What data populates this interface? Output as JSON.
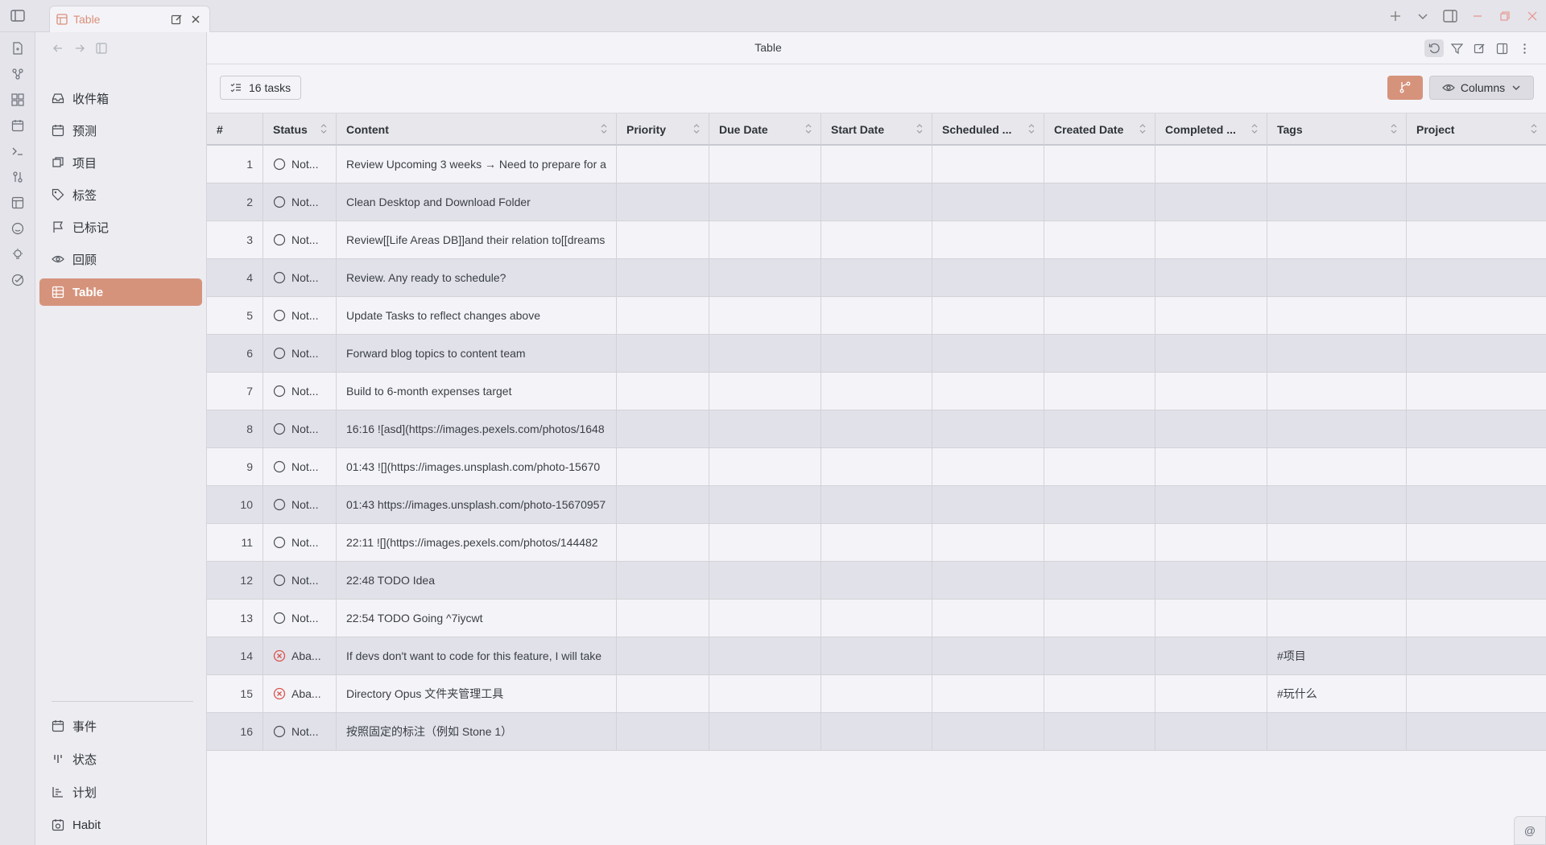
{
  "tab": {
    "label": "Table"
  },
  "header": {
    "title": "Table"
  },
  "sidebar": {
    "items": [
      {
        "label": "收件箱",
        "icon": "inbox-icon"
      },
      {
        "label": "预测",
        "icon": "calendar-icon"
      },
      {
        "label": "项目",
        "icon": "layers-icon"
      },
      {
        "label": "标签",
        "icon": "tag-icon"
      },
      {
        "label": "已标记",
        "icon": "flag-icon"
      },
      {
        "label": "回顾",
        "icon": "eye-icon"
      },
      {
        "label": "Table",
        "icon": "table-icon",
        "active": true
      }
    ],
    "bottom_items": [
      {
        "label": "事件",
        "icon": "calendar-icon"
      },
      {
        "label": "状态",
        "icon": "bars-icon"
      },
      {
        "label": "计划",
        "icon": "chart-icon"
      },
      {
        "label": "Habit",
        "icon": "habit-icon"
      }
    ]
  },
  "toolbar": {
    "task_count": "16 tasks",
    "columns_label": "Columns"
  },
  "table": {
    "headers": [
      "#",
      "Status",
      "Content",
      "Priority",
      "Due Date",
      "Start Date",
      "Scheduled ...",
      "Created Date",
      "Completed ...",
      "Tags",
      "Project"
    ],
    "rows": [
      {
        "n": "1",
        "status": "Not...",
        "state": "open",
        "content": "Review Upcoming 3 weeks → Need to prepare for a",
        "tags": ""
      },
      {
        "n": "2",
        "status": "Not...",
        "state": "open",
        "content": "Clean Desktop and Download Folder",
        "tags": ""
      },
      {
        "n": "3",
        "status": "Not...",
        "state": "open",
        "content": "Review[[Life Areas DB]]and their relation to[[dreams",
        "tags": ""
      },
      {
        "n": "4",
        "status": "Not...",
        "state": "open",
        "content": "Review. Any ready to schedule?",
        "tags": ""
      },
      {
        "n": "5",
        "status": "Not...",
        "state": "open",
        "content": "Update Tasks to reflect changes above",
        "tags": ""
      },
      {
        "n": "6",
        "status": "Not...",
        "state": "open",
        "content": "Forward blog topics to content team",
        "tags": ""
      },
      {
        "n": "7",
        "status": "Not...",
        "state": "open",
        "content": "Build to 6-month expenses target",
        "tags": ""
      },
      {
        "n": "8",
        "status": "Not...",
        "state": "open",
        "content": "16:16 ![asd](https://images.pexels.com/photos/1648",
        "tags": ""
      },
      {
        "n": "9",
        "status": "Not...",
        "state": "open",
        "content": "01:43 ![](https://images.unsplash.com/photo-15670",
        "tags": ""
      },
      {
        "n": "10",
        "status": "Not...",
        "state": "open",
        "content": "01:43 https://images.unsplash.com/photo-15670957",
        "tags": ""
      },
      {
        "n": "11",
        "status": "Not...",
        "state": "open",
        "content": "22:11 ![](https://images.pexels.com/photos/144482",
        "tags": ""
      },
      {
        "n": "12",
        "status": "Not...",
        "state": "open",
        "content": "22:48 TODO Idea",
        "tags": ""
      },
      {
        "n": "13",
        "status": "Not...",
        "state": "open",
        "content": "22:54 TODO Going ^7iycwt",
        "tags": ""
      },
      {
        "n": "14",
        "status": "Aba...",
        "state": "abandoned",
        "content": "If devs don't want to code for this feature, I will take",
        "tags": "#项目"
      },
      {
        "n": "15",
        "status": "Aba...",
        "state": "abandoned",
        "content": "Directory Opus 文件夹管理工具",
        "tags": "#玩什么"
      },
      {
        "n": "16",
        "status": "Not...",
        "state": "open",
        "content": "按照固定的标注（例如 Stone 1）",
        "tags": ""
      }
    ]
  },
  "colors": {
    "accent": "#d6937c",
    "abandoned": "#d9534f"
  },
  "corner": {
    "label": "@"
  }
}
